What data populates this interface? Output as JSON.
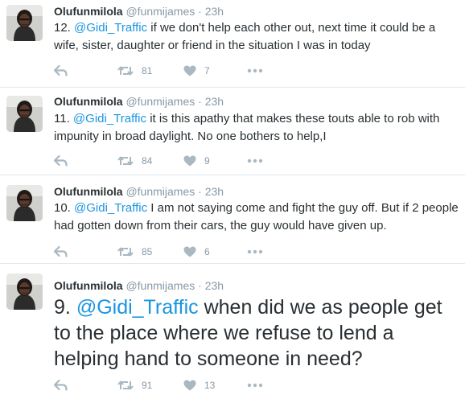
{
  "colors": {
    "link": "#1b95e0",
    "muted": "#8899a6",
    "text": "#292f33",
    "divider": "#e1e8ed"
  },
  "icons": {
    "reply": "reply-icon",
    "retweet": "retweet-icon",
    "like": "heart-icon",
    "more": "more-dots-icon"
  },
  "tweets": [
    {
      "name": "Olufunmilola",
      "handle": "@funmijames",
      "sep": "·",
      "time": "23h",
      "prefix": "12.",
      "mention": "@Gidi_Traffic",
      "body": "if we don't help each other out, next time it could be a wife, sister, daughter or friend in the situation I was in today",
      "retweets": "81",
      "likes": "7"
    },
    {
      "name": "Olufunmilola",
      "handle": "@funmijames",
      "sep": "·",
      "time": "23h",
      "prefix": "11.",
      "mention": "@Gidi_Traffic",
      "body": "it is this apathy that makes these touts able to rob with impunity in broad daylight. No one bothers to help,I",
      "retweets": "84",
      "likes": "9"
    },
    {
      "name": "Olufunmilola",
      "handle": "@funmijames",
      "sep": "·",
      "time": "23h",
      "prefix": "10.",
      "mention": "@Gidi_Traffic",
      "body": "I am not saying come and fight the guy off. But if 2 people had gotten down from their cars, the guy would have given up.",
      "retweets": "85",
      "likes": "6"
    },
    {
      "name": "Olufunmilola",
      "handle": "@funmijames",
      "sep": "·",
      "time": "23h",
      "prefix": "9.",
      "mention": "@Gidi_Traffic",
      "body": "when did we as people get to the place where we refuse to lend a helping hand to someone in need?",
      "retweets": "91",
      "likes": "13"
    }
  ]
}
